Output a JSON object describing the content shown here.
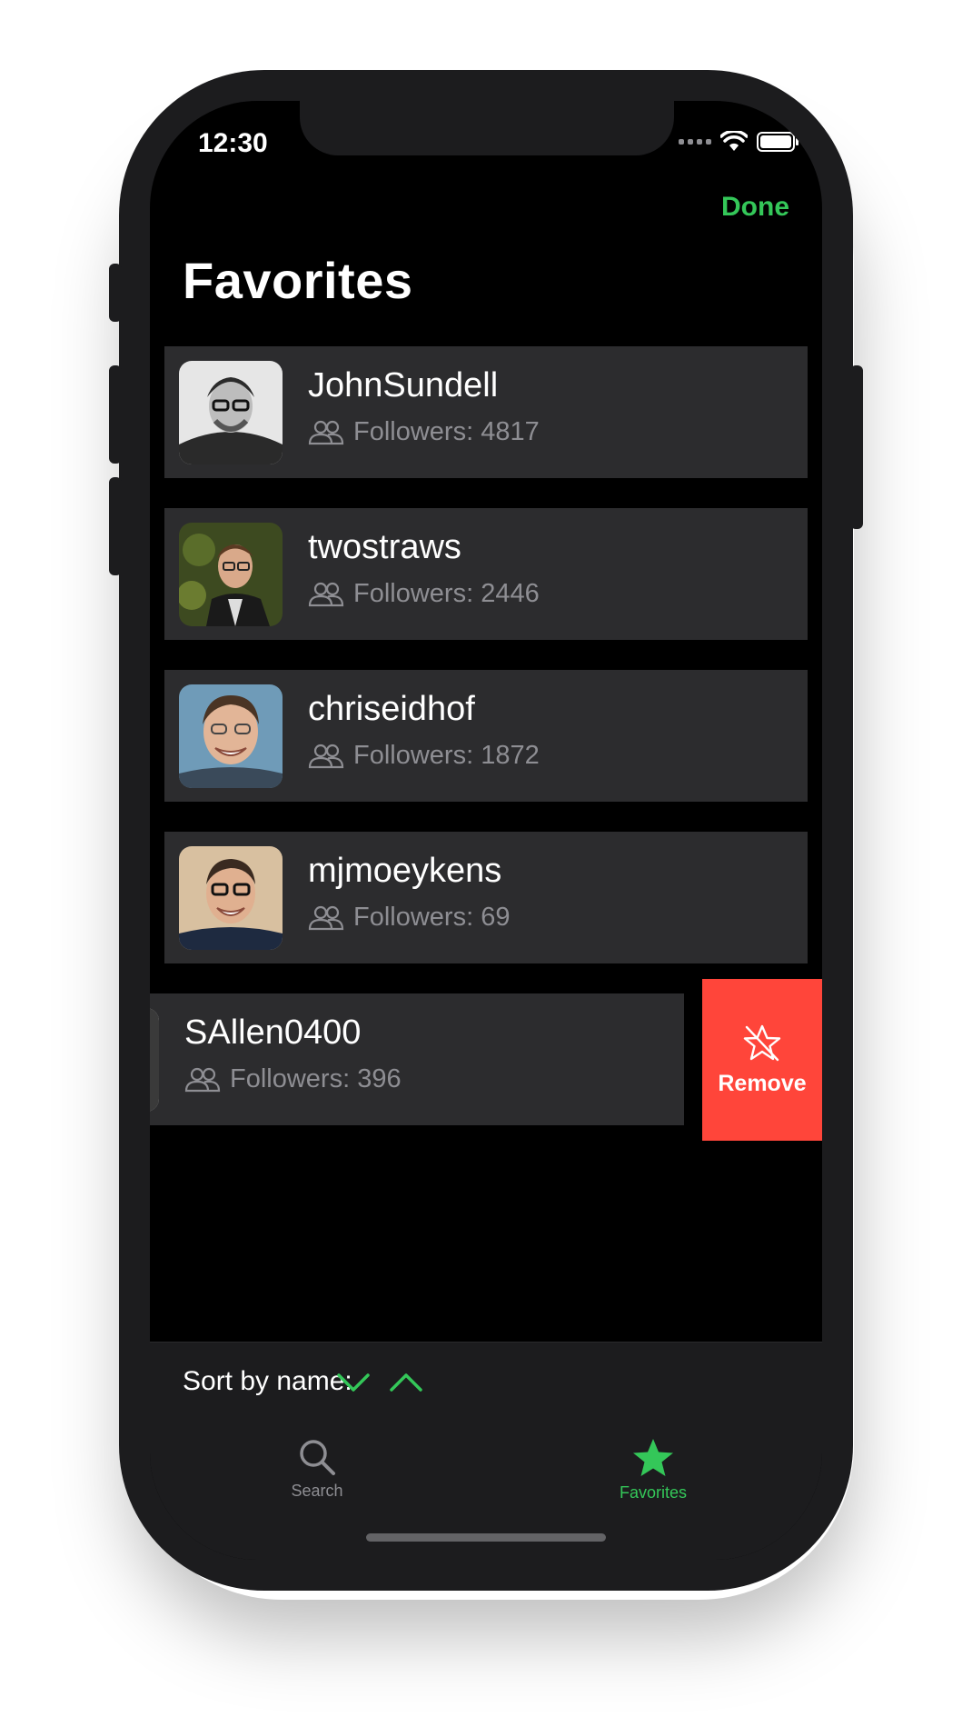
{
  "status_bar": {
    "time": "12:30"
  },
  "nav": {
    "done_label": "Done",
    "title": "Favorites"
  },
  "favorites": [
    {
      "username": "JohnSundell",
      "followers": "Followers: 4817"
    },
    {
      "username": "twostraws",
      "followers": "Followers: 2446"
    },
    {
      "username": "chriseidhof",
      "followers": "Followers: 1872"
    },
    {
      "username": "mjmoeykens",
      "followers": "Followers: 69"
    },
    {
      "username": "SAllen0400",
      "followers": "Followers: 396"
    }
  ],
  "swipe_action": {
    "label": "Remove",
    "color": "#ff453a"
  },
  "sort": {
    "label": "Sort by name:",
    "descending_icon": "chevron-down-icon",
    "ascending_icon": "chevron-up-icon"
  },
  "tabs": [
    {
      "label": "Search",
      "icon": "search-icon",
      "selected": false
    },
    {
      "label": "Favorites",
      "icon": "star-icon",
      "selected": true
    }
  ],
  "colors": {
    "accent": "#34c759",
    "row_background": "#2c2c2e",
    "destructive": "#ff453a"
  }
}
